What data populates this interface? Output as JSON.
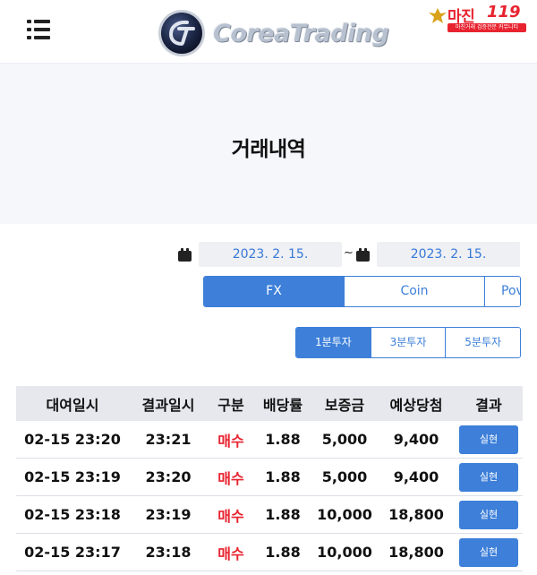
{
  "header": {
    "logo_text": "CoreaTrading",
    "badge": {
      "title": "마진",
      "number": "119",
      "subtitle": "마진거래 검증전문 커뮤니티"
    }
  },
  "page_title": "거래내역",
  "date_range": {
    "start": "2023. 2. 15.",
    "separator": "~",
    "end": "2023. 2. 15."
  },
  "market_tabs": [
    {
      "label": "FX",
      "active": true
    },
    {
      "label": "Coin",
      "active": false
    },
    {
      "label": "Pov",
      "active": false
    }
  ],
  "duration_tabs": [
    {
      "label": "1분투자",
      "active": true
    },
    {
      "label": "3분투자",
      "active": false
    },
    {
      "label": "5분투자",
      "active": false
    }
  ],
  "table": {
    "headers": [
      "대여일시",
      "결과일시",
      "구분",
      "배당률",
      "보증금",
      "예상당첨",
      "결과"
    ],
    "rows": [
      {
        "rent_time": "02-15 23:20",
        "result_time": "23:21",
        "type": "매수",
        "rate": "1.88",
        "deposit": "5,000",
        "expected": "9,400",
        "result": "실현"
      },
      {
        "rent_time": "02-15 23:19",
        "result_time": "23:20",
        "type": "매수",
        "rate": "1.88",
        "deposit": "5,000",
        "expected": "9,400",
        "result": "실현"
      },
      {
        "rent_time": "02-15 23:18",
        "result_time": "23:19",
        "type": "매수",
        "rate": "1.88",
        "deposit": "10,000",
        "expected": "18,800",
        "result": "실현"
      },
      {
        "rent_time": "02-15 23:17",
        "result_time": "23:18",
        "type": "매수",
        "rate": "1.88",
        "deposit": "10,000",
        "expected": "18,800",
        "result": "실현"
      }
    ]
  },
  "colors": {
    "accent": "#3d7fd9",
    "buy": "#e8232f",
    "badge": "#e8232f",
    "title_band": "#f6f7fb",
    "table_header": "#e6e8ee"
  },
  "icons": {
    "menu": "hamburger-menu-icon",
    "calendar": "calendar-icon",
    "logo": "corea-trading-emblem-icon"
  }
}
